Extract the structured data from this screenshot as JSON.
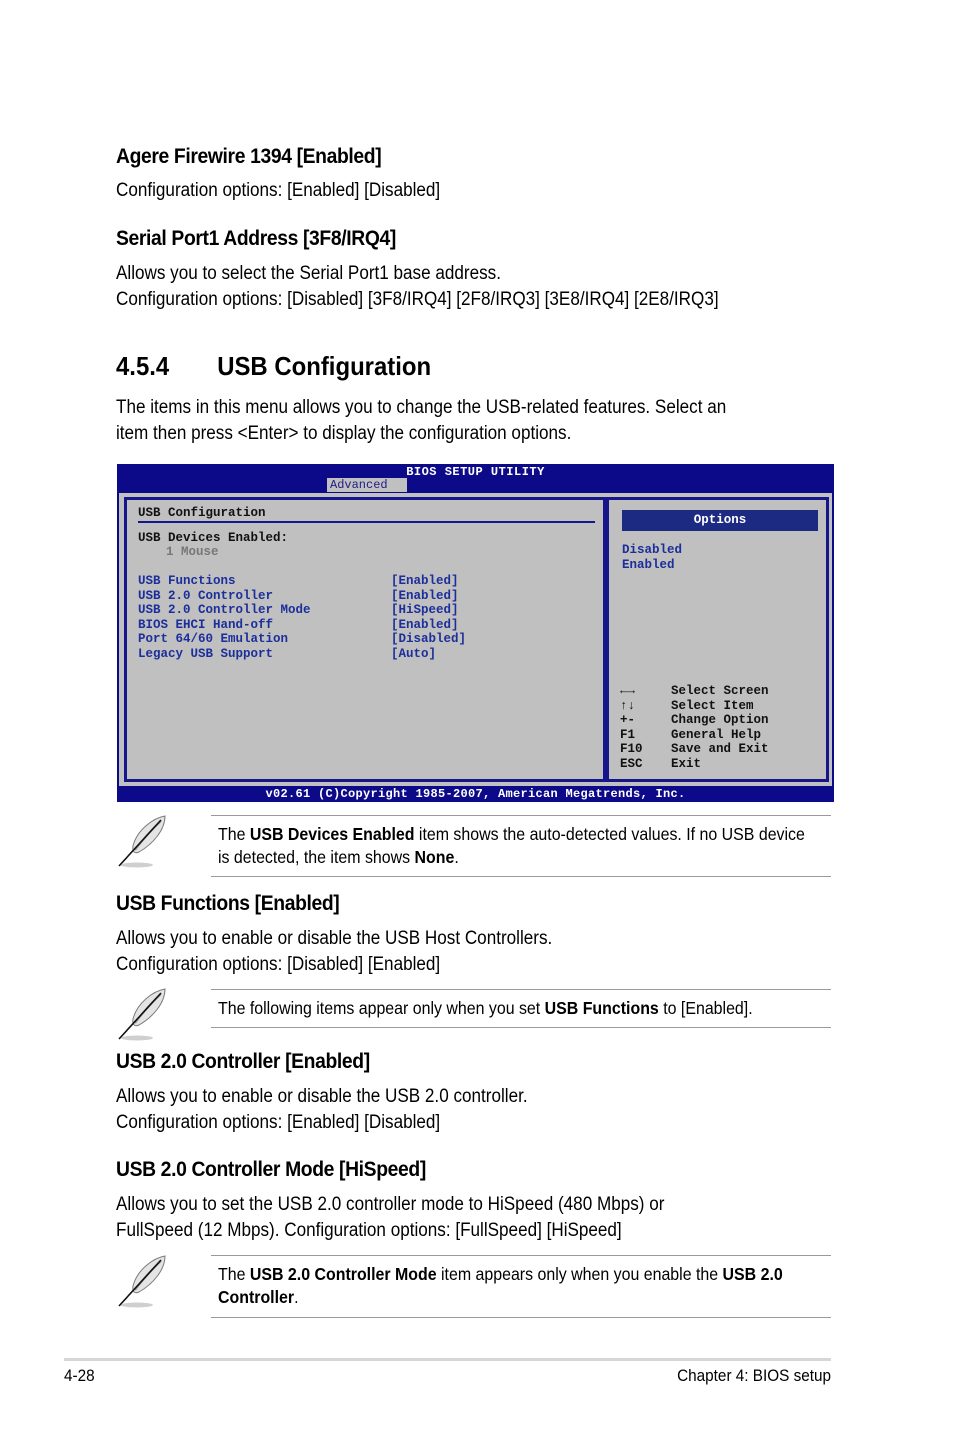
{
  "sections": {
    "firewire": {
      "heading": "Agere Firewire 1394 [Enabled]",
      "lines": [
        "Configuration options: [Enabled] [Disabled]"
      ]
    },
    "serial_port": {
      "heading": "Serial Port1 Address [3F8/IRQ4]",
      "lines": [
        "Allows you to select the Serial Port1 base address.",
        "Configuration options: [Disabled] [3F8/IRQ4] [2F8/IRQ3] [3E8/IRQ4] [2E8/IRQ3]"
      ]
    },
    "usb_config": {
      "number": "4.5.4",
      "title": "USB Configuration",
      "lines": [
        "The items in this menu allows you to change the USB-related features. Select an",
        "item then press <Enter> to display the configuration options."
      ]
    },
    "usb_functions": {
      "heading": "USB Functions [Enabled]",
      "lines": [
        "Allows you to enable or disable the USB Host Controllers.",
        "Configuration options: [Disabled] [Enabled]"
      ]
    },
    "usb20_controller": {
      "heading": "USB 2.0 Controller [Enabled]",
      "lines": [
        "Allows you to enable or disable the USB 2.0 controller.",
        "Configuration options: [Enabled] [Disabled]"
      ]
    },
    "usb20_mode": {
      "heading": "USB 2.0 Controller Mode [HiSpeed]",
      "lines": [
        "Allows you to set the USB 2.0 controller mode to HiSpeed (480 Mbps) or",
        "FullSpeed (12 Mbps). Configuration options: [FullSpeed] [HiSpeed]"
      ]
    }
  },
  "bios": {
    "title": "BIOS SETUP UTILITY",
    "active_tab": "Advanced",
    "section_title": "USB Configuration",
    "devices_label": "USB Devices Enabled:",
    "devices_value": "1 Mouse",
    "items": [
      {
        "name": "USB Functions",
        "value": "[Enabled]"
      },
      {
        "name": "USB 2.0 Controller",
        "value": "[Enabled]"
      },
      {
        "name": "USB 2.0 Controller Mode",
        "value": "[HiSpeed]"
      },
      {
        "name": "BIOS EHCI Hand-off",
        "value": "[Enabled]"
      },
      {
        "name": "Port 64/60 Emulation",
        "value": "[Disabled]"
      },
      {
        "name": "Legacy USB Support",
        "value": "[Auto]"
      }
    ],
    "options_header": "Options",
    "options": [
      "Disabled",
      "Enabled"
    ],
    "keys": [
      {
        "key": "←→",
        "action": "Select Screen",
        "icon": "left-right-arrows-icon"
      },
      {
        "key": "↑↓",
        "action": "Select Item",
        "icon": "up-down-arrows-icon"
      },
      {
        "key": "+-",
        "action": "Change Option"
      },
      {
        "key": "F1",
        "action": "General Help"
      },
      {
        "key": "F10",
        "action": "Save and Exit"
      },
      {
        "key": "ESC",
        "action": "Exit"
      }
    ],
    "footer": "v02.61 (C)Copyright 1985-2007, American Megatrends, Inc.",
    "colors": {
      "frame": "#0d0a8a",
      "panel": "#c0c0c0",
      "item_text": "#1c2e9a",
      "options_bar": "#1c2a82"
    }
  },
  "notes": [
    {
      "parts": [
        {
          "text": "The ",
          "bold": false
        },
        {
          "text": "USB Devices Enabled",
          "bold": true
        },
        {
          "text": " item shows the auto-detected values. If no USB device is detected, the item shows ",
          "bold": false
        },
        {
          "text": "None",
          "bold": true
        },
        {
          "text": ".",
          "bold": false
        }
      ]
    },
    {
      "parts": [
        {
          "text": "The following items appear only when you set ",
          "bold": false
        },
        {
          "text": "USB Functions",
          "bold": true
        },
        {
          "text": " to [Enabled].",
          "bold": false
        }
      ]
    },
    {
      "parts": [
        {
          "text": "The ",
          "bold": false
        },
        {
          "text": "USB 2.0 Controller Mode",
          "bold": true
        },
        {
          "text": " item appears only when you enable the ",
          "bold": false
        },
        {
          "text": "USB 2.0 Controller",
          "bold": true
        },
        {
          "text": ".",
          "bold": false
        }
      ]
    }
  ],
  "footer": {
    "page_number": "4-28",
    "chapter": "Chapter 4: BIOS setup"
  }
}
